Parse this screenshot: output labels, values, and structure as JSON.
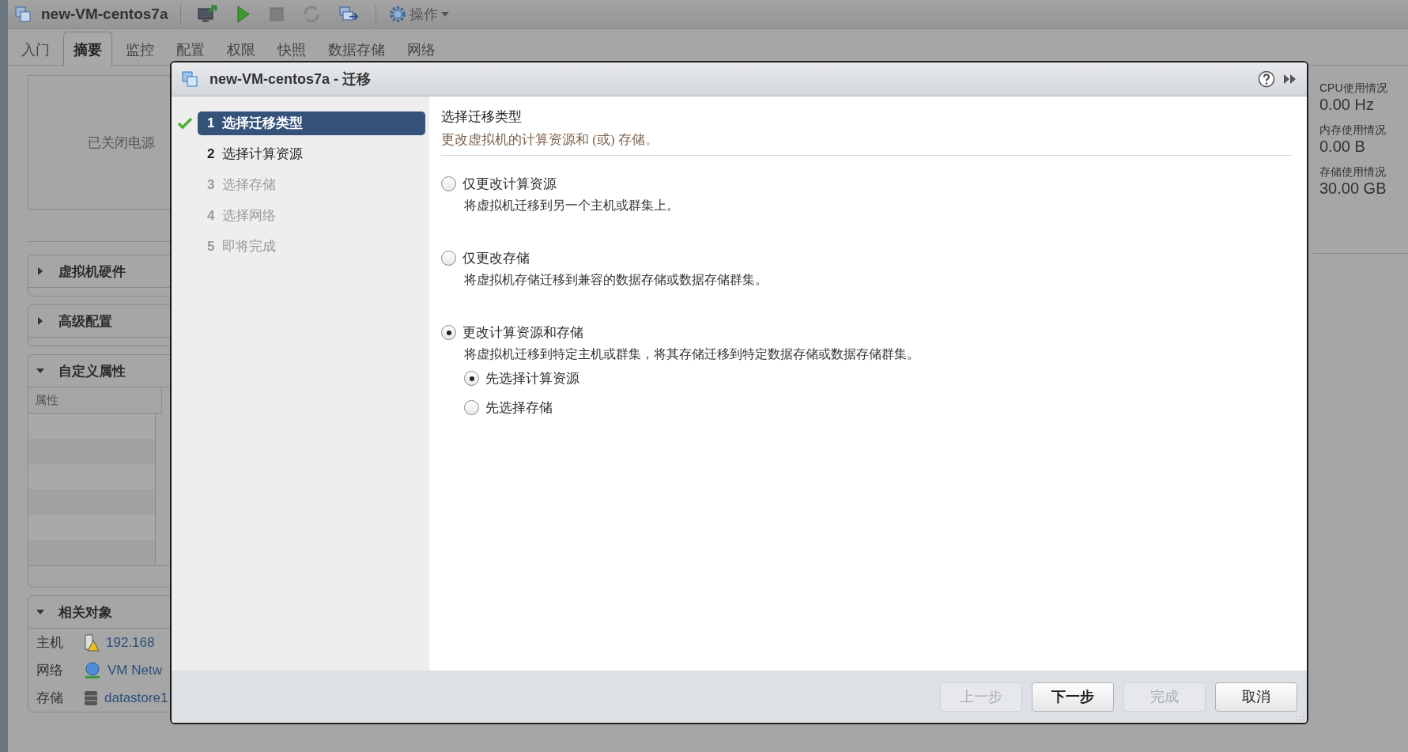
{
  "app": {
    "title": "new-VM-centos7a",
    "actions_menu": "操作"
  },
  "tabs": [
    {
      "label": "入门",
      "selected": false
    },
    {
      "label": "摘要",
      "selected": true
    },
    {
      "label": "监控",
      "selected": false
    },
    {
      "label": "配置",
      "selected": false
    },
    {
      "label": "权限",
      "selected": false
    },
    {
      "label": "快照",
      "selected": false
    },
    {
      "label": "数据存储",
      "selected": false
    },
    {
      "label": "网络",
      "selected": false
    }
  ],
  "power_state": "已关闭电源",
  "sections": [
    {
      "kind": "plain",
      "title": "虚拟机硬件",
      "expanded": false
    },
    {
      "kind": "plain",
      "title": "高级配置",
      "expanded": false
    },
    {
      "kind": "table",
      "title": "自定义属性",
      "expanded": true,
      "column_1": "属性"
    },
    {
      "kind": "related",
      "title": "相关对象",
      "expanded": true,
      "rows": [
        {
          "label": "主机",
          "value": "192.168",
          "kind": "host"
        },
        {
          "label": "网络",
          "value": "VM Netw",
          "kind": "network"
        },
        {
          "label": "存储",
          "value": "datastore1",
          "kind": "storage"
        }
      ]
    }
  ],
  "usage": [
    {
      "label": "CPU使用情况",
      "value": "0.00 Hz"
    },
    {
      "label": "内存使用情况",
      "value": "0.00 B"
    },
    {
      "label": "存储使用情况",
      "value": "30.00 GB"
    }
  ],
  "dialog": {
    "title": "new-VM-centos7a - 迁移",
    "steps": [
      {
        "number": "1",
        "label": "选择迁移类型",
        "selected": true,
        "completed": true,
        "disabled": false
      },
      {
        "number": "2",
        "label": "选择计算资源",
        "selected": false,
        "completed": false,
        "disabled": false
      },
      {
        "number": "3",
        "label": "选择存储",
        "selected": false,
        "completed": false,
        "disabled": true
      },
      {
        "number": "4",
        "label": "选择网络",
        "selected": false,
        "completed": false,
        "disabled": true
      },
      {
        "number": "5",
        "label": "即将完成",
        "selected": false,
        "completed": false,
        "disabled": true
      }
    ],
    "heading": "选择迁移类型",
    "subtitle": "更改虚拟机的计算资源和 (或) 存储。",
    "options": [
      {
        "label": "仅更改计算资源",
        "description": "将虚拟机迁移到另一个主机或群集上。",
        "selected": false
      },
      {
        "label": "仅更改存储",
        "description": "将虚拟机存储迁移到兼容的数据存储或数据存储群集。",
        "selected": false
      },
      {
        "label": "更改计算资源和存储",
        "description": "将虚拟机迁移到特定主机或群集，将其存储迁移到特定数据存储或数据存储群集。",
        "selected": true
      }
    ],
    "sub_options": [
      {
        "label": "先选择计算资源",
        "selected": true
      },
      {
        "label": "先选择存储",
        "selected": false
      }
    ],
    "buttons": [
      {
        "label": "上一步",
        "disabled": true,
        "primary": false
      },
      {
        "label": "下一步",
        "disabled": false,
        "primary": true
      },
      {
        "label": "完成",
        "disabled": true,
        "primary": false
      },
      {
        "label": "取消",
        "disabled": false,
        "primary": false
      }
    ]
  }
}
